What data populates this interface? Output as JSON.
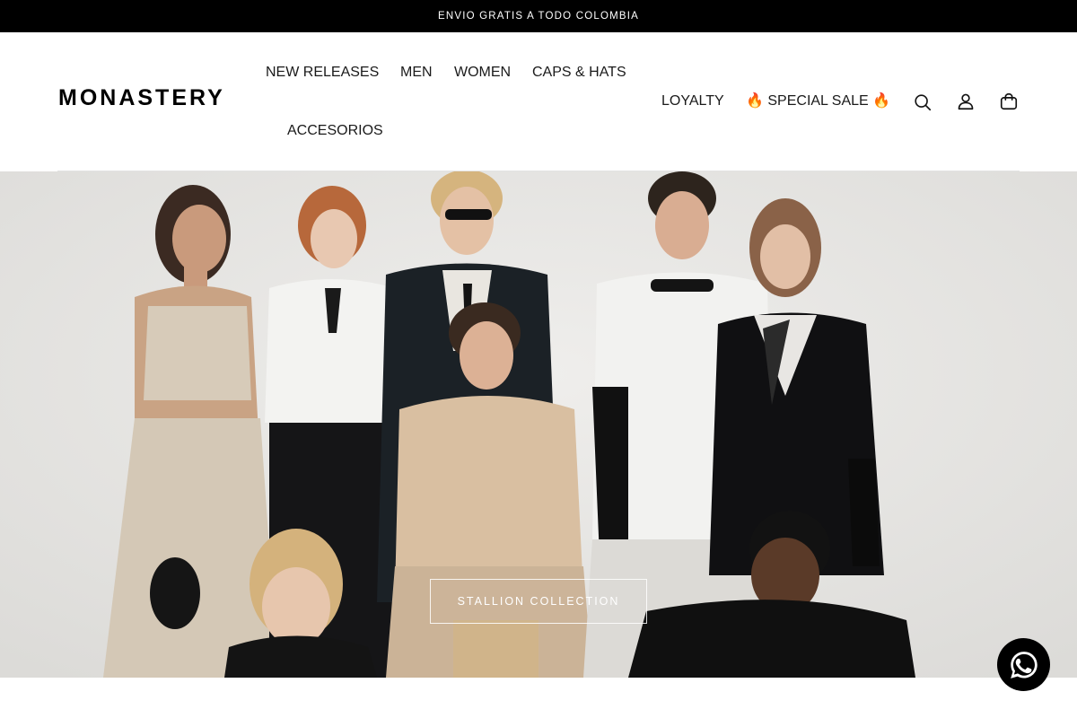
{
  "announcement": {
    "text": "ENVIO GRATIS A TODO COLOMBIA"
  },
  "header": {
    "logo_text": "MONASTERY",
    "nav": [
      {
        "label": "NEW RELEASES"
      },
      {
        "label": "MEN"
      },
      {
        "label": "WOMEN"
      },
      {
        "label": "CAPS & HATS"
      },
      {
        "label": "ACCESORIOS"
      },
      {
        "label": "LOYALTY"
      },
      {
        "label": "🔥 SPECIAL SALE 🔥"
      }
    ],
    "icons": [
      "search-icon",
      "account-icon",
      "cart-icon"
    ]
  },
  "hero": {
    "cta_label": "STALLION COLLECTION",
    "background_color": "#e9e8e6"
  },
  "floating": {
    "icon": "whatsapp-icon",
    "color": "#000000"
  },
  "colors": {
    "announcement_bg": "#000000",
    "text": "#1a1a1a",
    "accent": "#000000"
  }
}
